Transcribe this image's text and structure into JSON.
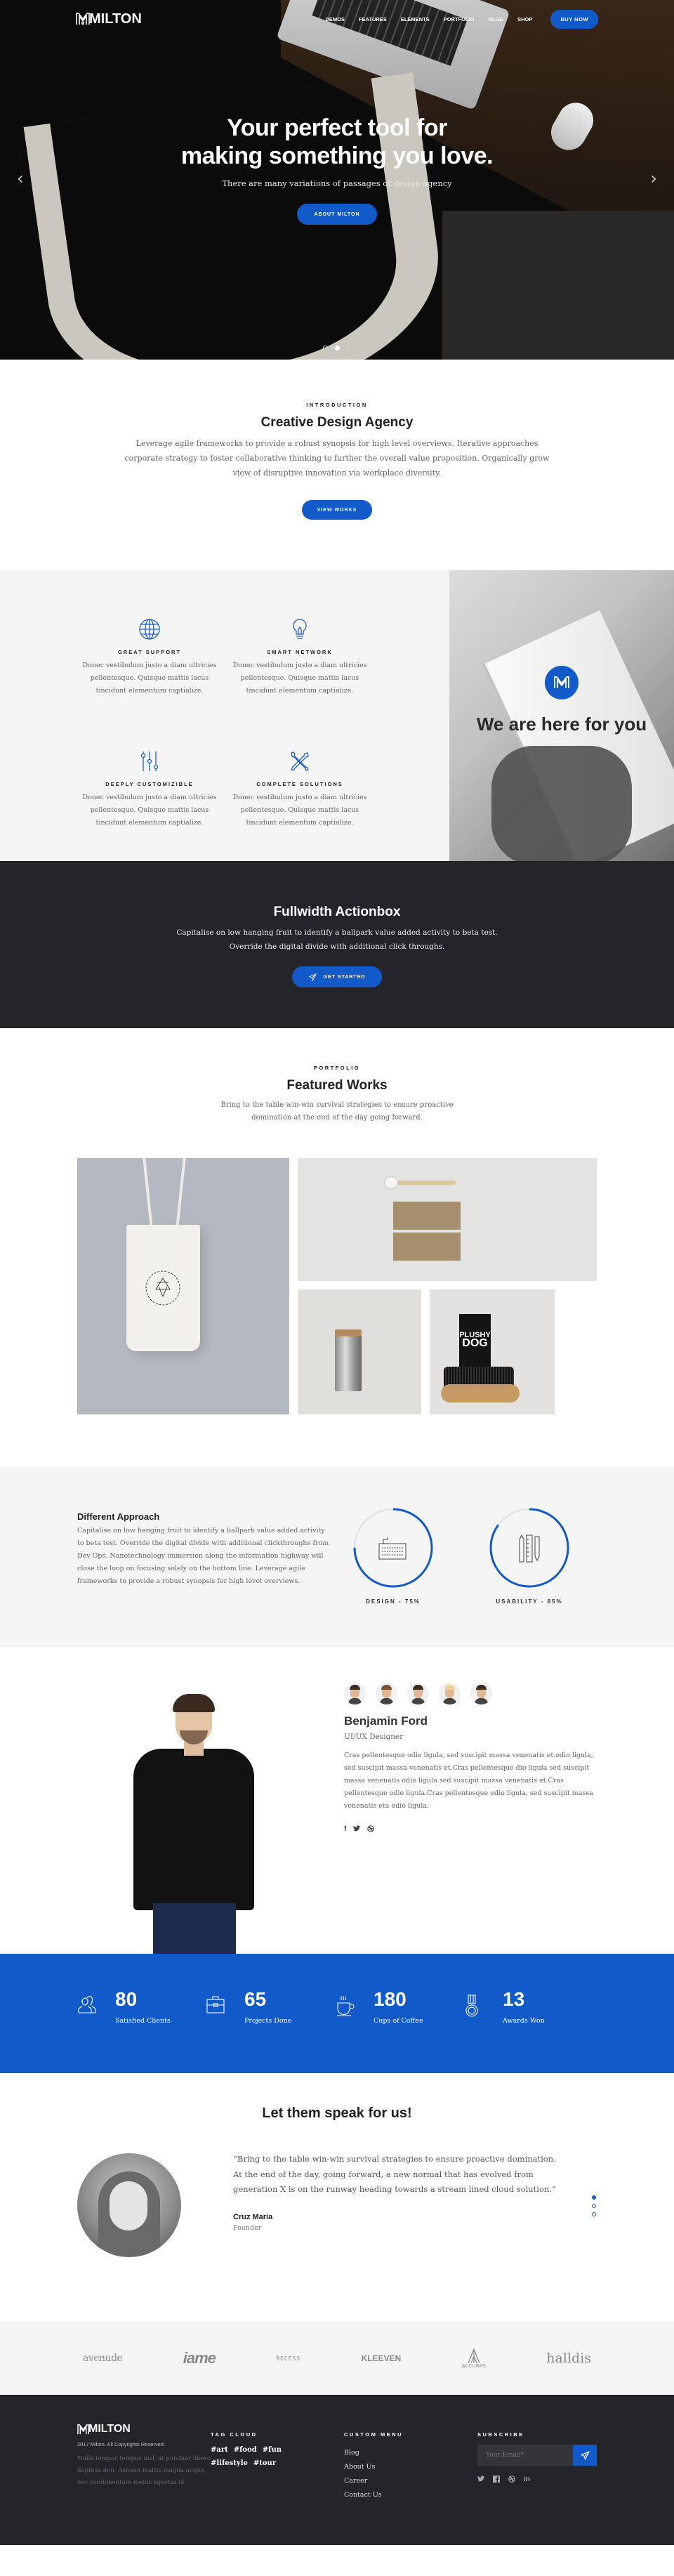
{
  "brand": {
    "name": "MILTON",
    "accent": "#1259c9",
    "dark": "#24252b"
  },
  "nav": {
    "items": [
      "Demos",
      "Features",
      "Elements",
      "Portfolio",
      "Blog",
      "Shop"
    ],
    "cta": "Buy Now"
  },
  "hero": {
    "title_line1": "Your perfect tool for",
    "title_line2": "making something you love.",
    "subtitle": "There are many variations of passages of design agency",
    "button": "About Milton",
    "prev_icon": "‹",
    "next_icon": "›",
    "slides": 3,
    "active_slide": 2
  },
  "intro": {
    "eyebrow": "Introduction",
    "title": "Creative Design Agency",
    "text": "Leverage agile frameworks to provide a robust synopsis for high level overviews. Iterative approaches corporate strategy to foster collaborative thinking to further the overall value proposition. Organically grow view of disruptive innovation via workplace diversity.",
    "button": "View Works"
  },
  "features": {
    "items": [
      {
        "icon": "globe-icon",
        "title": "Great Support",
        "text": "Donec vestibulum justo a diam ultricies pellentesque. Quisque mattis lacus tincidunt elementum captialize."
      },
      {
        "icon": "lightbulb-icon",
        "title": "Smart Network",
        "text": "Donec vestibulum justo a diam ultricies pellentesque. Quisque mattis lacus tincidunt elementum captialize."
      },
      {
        "icon": "sliders-icon",
        "title": "Deeply Customizible",
        "text": "Donec vestibulum justo a diam ultricies pellentesque. Quisque mattis lacus tincidunt elementum captialize."
      },
      {
        "icon": "tools-icon",
        "title": "Complete Solutions",
        "text": "Donec vestibulum justo a diam ultricies pellentesque. Quisque mattis lacus tincidunt elementum captialize."
      }
    ],
    "photo_title": "We are here for you"
  },
  "actionbox": {
    "title": "Fullwidth Actionbox",
    "line1": "Capitalise on low hanging fruit to identify a ballpark value added activity to beta test.",
    "line2": "Override the digital divide with additional click throughs.",
    "button": "Get Started"
  },
  "portfolio": {
    "eyebrow": "Portfolio",
    "title": "Featured Works",
    "text": "Bring to the table win-win survival strategies to ensure proactive domination at the end of the day going forward.",
    "works": [
      {
        "name": "tote-bag"
      },
      {
        "name": "spoon-envelopes"
      },
      {
        "name": "steel-jar"
      },
      {
        "name": "plushy-dog-brush",
        "label_line1": "PLUSHY",
        "label_line2": "DOG"
      }
    ]
  },
  "approach": {
    "title": "Different Approach",
    "text": "Capitalise on low hanging fruit to identify a ballpark value added activity to beta test. Override the digital divide with additional clickthroughs from Dev Ops. Nanotechnology immersion along the information highway will close the loop on focusing solely on the bottom line. Leverage agile frameworks to provide a robust synopsis for high level overviews.",
    "skills": [
      {
        "label": "Design - 75%",
        "percent": 75,
        "icon": "keyboard-icon"
      },
      {
        "label": "Usability - 85%",
        "percent": 85,
        "icon": "stationery-icon"
      }
    ]
  },
  "team": {
    "member_count": 5,
    "name": "Benjamin Ford",
    "role": "UI/UX Designer",
    "bio": "Cras pellentesque odio ligula, sed suscipit massa venenatis et.odio ligula, sed suscipit massa venenatis et.Cras pellentesque dio ligula sed suscipit massa venenatis odio ligula sed suscipit massa venenatis et.Cras pellentesque odio ligula.Cras pellentesque odio ligula, sed suscipit massa venenatis eta odio ligula.",
    "social": [
      "f",
      "t",
      "dribbble"
    ]
  },
  "stats": [
    {
      "icon": "users-icon",
      "value": "80",
      "label": "Satisfied Clients"
    },
    {
      "icon": "briefcase-icon",
      "value": "65",
      "label": "Projects Done"
    },
    {
      "icon": "coffee-icon",
      "value": "180",
      "label": "Cups of Coffee"
    },
    {
      "icon": "medal-icon",
      "value": "13",
      "label": "Awards Won"
    }
  ],
  "testimonials": {
    "title": "Let them speak for us!",
    "quote": "“Bring to the table win-win survival strategies to ensure proactive domination. At the end of the day, going forward, a new normal that has evolved from generation X is on the runway heading towards a stream lined cloud solution.”",
    "name": "Cruz Maria",
    "position": "Founder",
    "slides": 3,
    "active_slide": 1
  },
  "clients": [
    "avenude",
    "iame",
    "RECESS",
    "KLEEVEN",
    "ACCURAS",
    "halldis"
  ],
  "footer": {
    "logo": "MILTON",
    "copyright": "2017 Milton. All Copyrights Reserved.",
    "description": "Nulla tempor tempus nisl, at pulvinar libero dapibus non. Aenean mattis magna augue, nec condimentum metus egestas id.",
    "tag_title": "Tag Cloud",
    "tags": [
      "#art",
      "#food",
      "#fun",
      "#lifestyle",
      "#tour"
    ],
    "menu_title": "Custom Menu",
    "menu": [
      "Blog",
      "About Us",
      "Career",
      "Contact Us"
    ],
    "subscribe_title": "Subscribe",
    "email_placeholder": "Your Email*",
    "social": [
      "twitter",
      "facebook",
      "dribbble",
      "linkedin"
    ]
  }
}
